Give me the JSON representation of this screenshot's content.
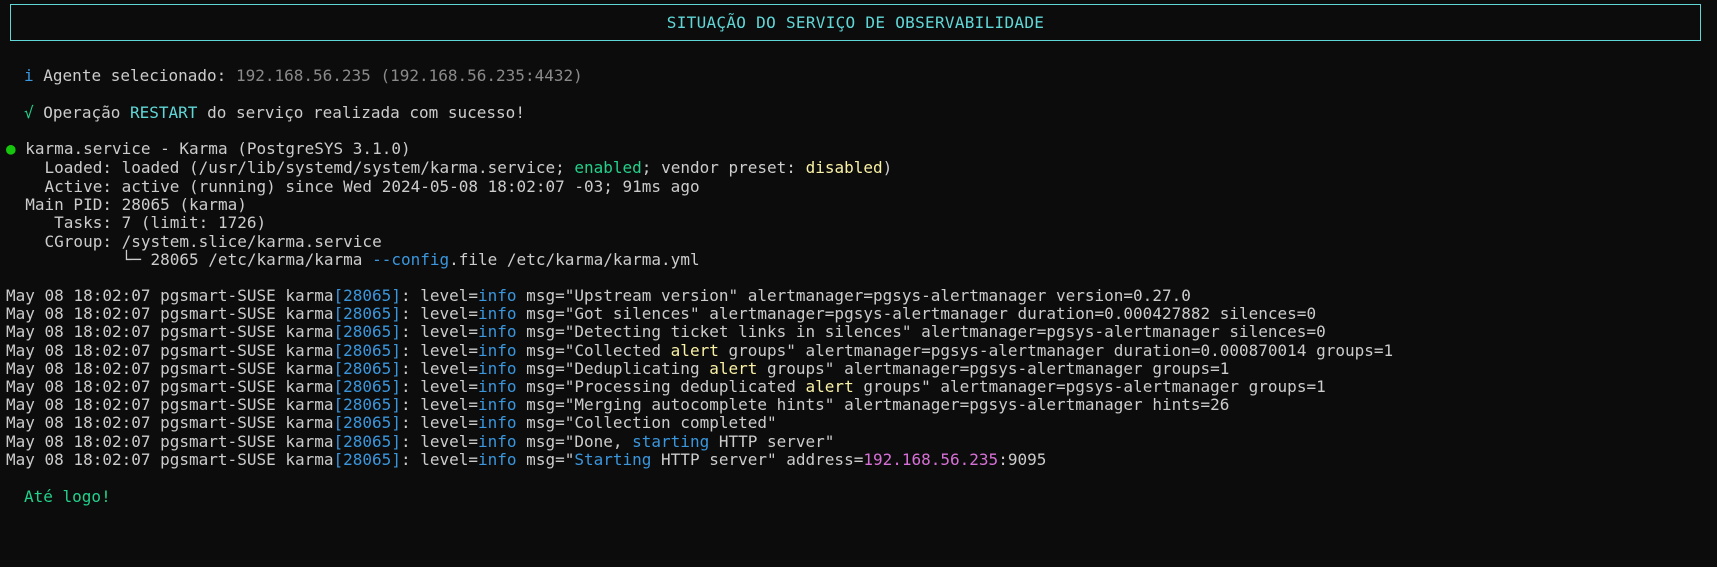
{
  "banner": {
    "title": "SITUAÇÃO DO SERVIÇO DE OBSERVABILIDADE"
  },
  "agent": {
    "icon": "i",
    "label": "Agente selecionado:",
    "value": "192.168.56.235 (192.168.56.235:4432)"
  },
  "operation": {
    "icon": "√",
    "prefix": "Operação",
    "action": "RESTART",
    "suffix": "do serviço realizada com sucesso!"
  },
  "status": {
    "bullet": "●",
    "title": "karma.service - Karma (PostgreSYS 3.1.0)",
    "loaded_label": "Loaded:",
    "loaded_pre": "loaded (/usr/lib/systemd/system/karma.service;",
    "loaded_enabled": "enabled",
    "loaded_mid": "; vendor preset:",
    "loaded_disabled": "disabled",
    "loaded_post": ")",
    "active_label": "Active:",
    "active_value": "active (running) since Wed 2024-05-08 18:02:07 -03; 91ms ago",
    "pid_label": "Main PID:",
    "pid_value": "28065 (karma)",
    "tasks_label": "Tasks:",
    "tasks_value": "7 (limit: 1726)",
    "cgroup_label": "CGroup:",
    "cgroup_value": "/system.slice/karma.service",
    "cgroup_tree": "└─",
    "cgroup_proc_pre": "28065 /etc/karma/karma",
    "cgroup_proc_flag": "--config",
    "cgroup_proc_post": ".file /etc/karma/karma.yml"
  },
  "log": {
    "prefix": "May 08 18:02:07 pgsmart-SUSE karma",
    "pid": "[28065]",
    "level_label": ": level=",
    "level": "info",
    "lines": [
      {
        "a": " msg=\"Upstream version\" alertmanager=pgsys-alertmanager version=0.27.0",
        "hl": "",
        "b": ""
      },
      {
        "a": " msg=\"Got silences\" alertmanager=pgsys-alertmanager duration=0.000427882 silences=0",
        "hl": "",
        "b": ""
      },
      {
        "a": " msg=\"Detecting ticket links in silences\" alertmanager=pgsys-alertmanager silences=0",
        "hl": "",
        "b": ""
      },
      {
        "a": " msg=\"Collected ",
        "hl": "alert",
        "b": " groups\" alertmanager=pgsys-alertmanager duration=0.000870014 groups=1"
      },
      {
        "a": " msg=\"Deduplicating ",
        "hl": "alert",
        "b": " groups\" alertmanager=pgsys-alertmanager groups=1"
      },
      {
        "a": " msg=\"Processing deduplicated ",
        "hl": "alert",
        "b": " groups\" alertmanager=pgsys-alertmanager groups=1"
      },
      {
        "a": " msg=\"Merging autocomplete hints\" alertmanager=pgsys-alertmanager hints=26",
        "hl": "",
        "b": ""
      },
      {
        "a": " msg=\"Collection completed\"",
        "hl": "",
        "b": ""
      },
      {
        "a": " msg=\"Done, ",
        "hl2": "starting",
        "b": " HTTP server\""
      },
      {
        "a": " msg=\"",
        "hl2": "Starting",
        "b": " HTTP server\" address=",
        "ip": "192.168.56.235",
        "port": ":9095"
      }
    ]
  },
  "farewell": "Até logo!"
}
